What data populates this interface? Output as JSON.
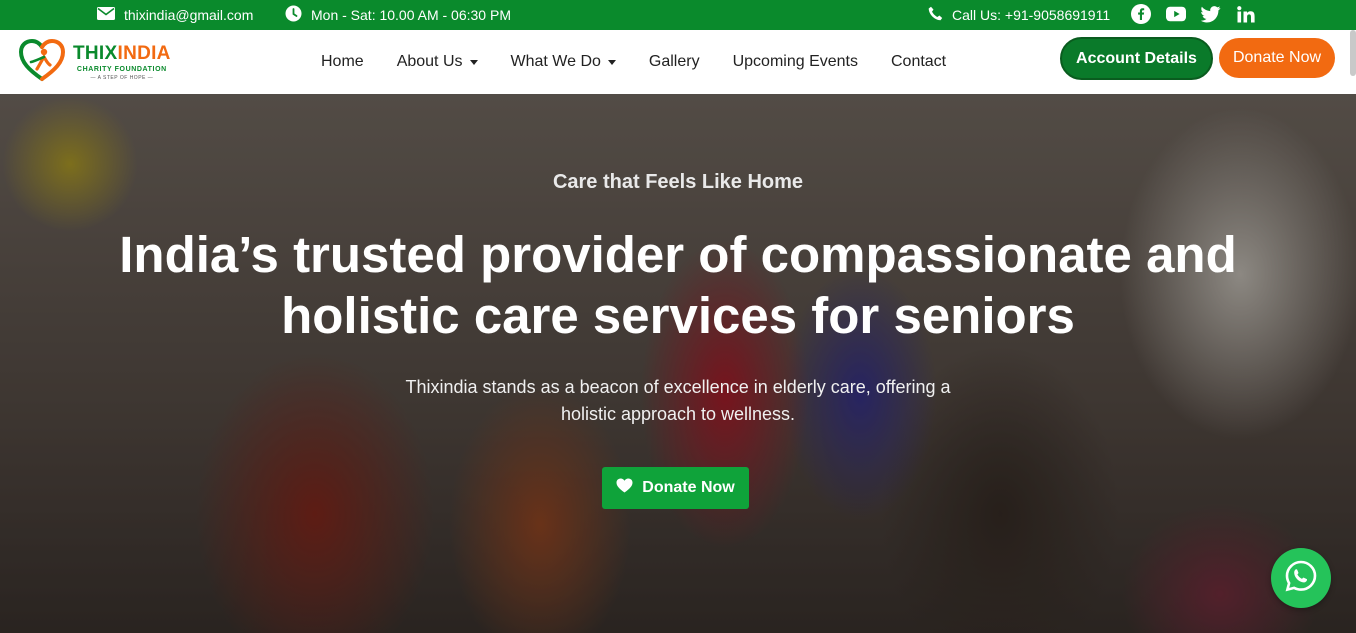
{
  "topbar": {
    "email": "thixindia@gmail.com",
    "hours": "Mon - Sat: 10.00 AM - 06:30 PM",
    "phone": "Call Us: +91-9058691911",
    "social_icons": [
      "facebook-icon",
      "youtube-icon",
      "twitter-icon",
      "linkedin-icon"
    ]
  },
  "logo": {
    "title_main": "THIX",
    "title_accent": "INDIA",
    "subtitle": "CHARITY FOUNDATION",
    "tagline": "A STEP OF HOPE"
  },
  "nav": {
    "items": [
      {
        "label": "Home",
        "dropdown": false
      },
      {
        "label": "About Us",
        "dropdown": true
      },
      {
        "label": "What We Do",
        "dropdown": true
      },
      {
        "label": "Gallery",
        "dropdown": false
      },
      {
        "label": "Upcoming Events",
        "dropdown": false
      },
      {
        "label": "Contact",
        "dropdown": false
      }
    ],
    "account_label": "Account Details",
    "donate_label": "Donate Now"
  },
  "hero": {
    "eyebrow": "Care that Feels Like Home",
    "title_line1": "India’s trusted provider of compassionate and",
    "title_line2": "holistic care services for seniors",
    "desc_line1": "Thixindia stands as a beacon of excellence in elderly care, offering a",
    "desc_line2": "holistic approach to wellness.",
    "button_label": "Donate Now"
  },
  "colors": {
    "brand_green": "#0a8a2c",
    "accent_orange": "#f26a11",
    "button_green": "#0fa33a",
    "whatsapp_green": "#25c35a"
  }
}
